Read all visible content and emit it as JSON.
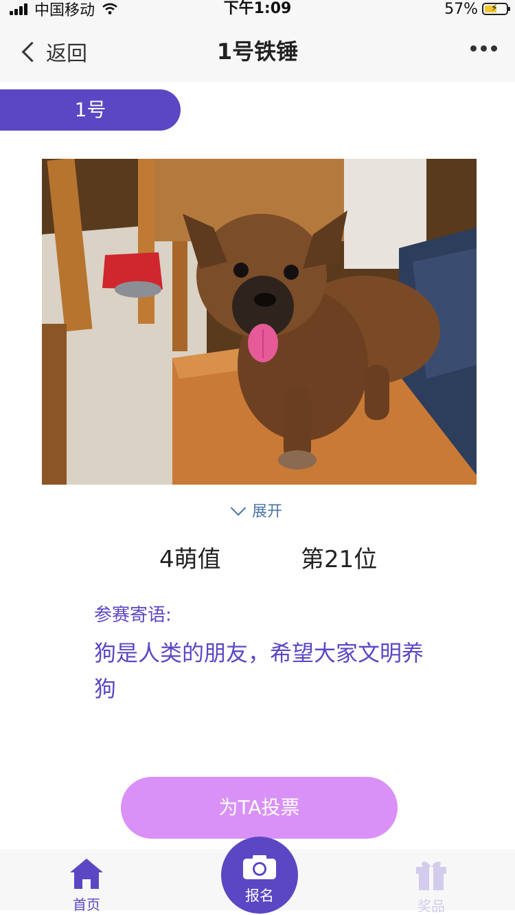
{
  "status_bar": {
    "carrier": "中国移动",
    "time": "下午1:09",
    "battery_percent": "57%",
    "battery_level": 0.57
  },
  "nav": {
    "back_label": "返回",
    "title": "1号铁锤"
  },
  "entry": {
    "number_tab": "1号",
    "expand_label": "展开",
    "cute_value": "4萌值",
    "rank": "第21位",
    "motto_label": "参赛寄语:",
    "motto_text": "狗是人类的朋友，希望大家文明养狗"
  },
  "vote_button_label": "为TA投票",
  "tab_bar": {
    "home": "首页",
    "signup": "报名",
    "prizes": "奖品"
  },
  "colors": {
    "primary": "#5b47c3",
    "vote_button": "#d991f7",
    "link": "#4a74a7",
    "inactive_tab": "#d4ccec"
  }
}
